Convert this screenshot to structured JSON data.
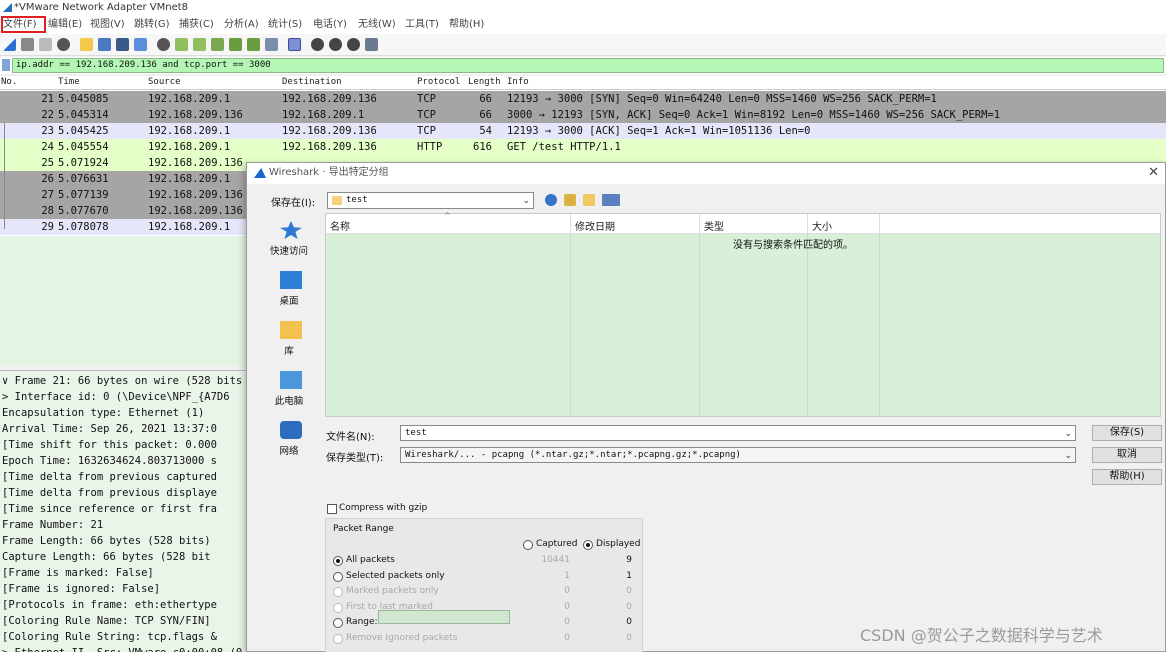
{
  "window": {
    "title": "*VMware Network Adapter VMnet8"
  },
  "menu": [
    "文件(F)",
    "编辑(E)",
    "视图(V)",
    "跳转(G)",
    "捕获(C)",
    "分析(A)",
    "统计(S)",
    "电话(Y)",
    "无线(W)",
    "工具(T)",
    "帮助(H)"
  ],
  "filter": {
    "value": "ip.addr == 192.168.209.136 and tcp.port == 3000"
  },
  "packet_list": {
    "columns": [
      "No.",
      "Time",
      "Source",
      "Destination",
      "Protocol",
      "Length",
      "Info"
    ],
    "rows": [
      {
        "no": "21",
        "time": "5.045085",
        "src": "192.168.209.1",
        "dst": "192.168.209.136",
        "proto": "TCP",
        "len": "66",
        "info": "12193 → 3000 [SYN] Seq=0 Win=64240 Len=0 MSS=1460 WS=256 SACK_PERM=1",
        "bg": "#a5a5a5"
      },
      {
        "no": "22",
        "time": "5.045314",
        "src": "192.168.209.136",
        "dst": "192.168.209.1",
        "proto": "TCP",
        "len": "66",
        "info": "3000 → 12193 [SYN, ACK] Seq=0 Ack=1 Win=8192 Len=0 MSS=1460 WS=256 SACK_PERM=1",
        "bg": "#a5a5a5"
      },
      {
        "no": "23",
        "time": "5.045425",
        "src": "192.168.209.1",
        "dst": "192.168.209.136",
        "proto": "TCP",
        "len": "54",
        "info": "12193 → 3000 [ACK] Seq=1 Ack=1 Win=1051136 Len=0",
        "bg": "#e6e6fa"
      },
      {
        "no": "24",
        "time": "5.045554",
        "src": "192.168.209.1",
        "dst": "192.168.209.136",
        "proto": "HTTP",
        "len": "616",
        "info": "GET /test HTTP/1.1",
        "bg": "#e4ffc7"
      },
      {
        "no": "25",
        "time": "5.071924",
        "src": "192.168.209.136",
        "dst": "",
        "proto": "",
        "len": "",
        "info": "",
        "bg": "#e4ffc7"
      },
      {
        "no": "26",
        "time": "5.076631",
        "src": "192.168.209.1",
        "dst": "",
        "proto": "",
        "len": "",
        "info": "",
        "bg": "#a5a5a5"
      },
      {
        "no": "27",
        "time": "5.077139",
        "src": "192.168.209.136",
        "dst": "",
        "proto": "",
        "len": "",
        "info": "",
        "bg": "#a5a5a5"
      },
      {
        "no": "28",
        "time": "5.077670",
        "src": "192.168.209.136",
        "dst": "",
        "proto": "",
        "len": "",
        "info": "",
        "bg": "#a5a5a5"
      },
      {
        "no": "29",
        "time": "5.078078",
        "src": "192.168.209.1",
        "dst": "",
        "proto": "",
        "len": "",
        "info": "",
        "bg": "#e6e6fa"
      }
    ]
  },
  "details": [
    "∨ Frame 21: 66 bytes on wire (528 bits",
    "  > Interface id: 0 (\\Device\\NPF_{A7D6",
    "    Encapsulation type: Ethernet (1)",
    "    Arrival Time: Sep 26, 2021 13:37:0",
    "    [Time shift for this packet: 0.000",
    "    Epoch Time: 1632634624.803713000 s",
    "    [Time delta from previous captured",
    "    [Time delta from previous displaye",
    "    [Time since reference or first fra",
    "    Frame Number: 21",
    "    Frame Length: 66 bytes (528 bits)",
    "    Capture Length: 66 bytes (528 bit",
    "    [Frame is marked: False]",
    "    [Frame is ignored: False]",
    "    [Protocols in frame: eth:ethertype",
    "    [Coloring Rule Name: TCP SYN/FIN]",
    "    [Coloring Rule String: tcp.flags &",
    "> Ethernet II, Src: VMware_c0:00:08 (0"
  ],
  "dialog": {
    "title": "Wireshark · 导出特定分组",
    "save_in_label": "保存在(I):",
    "save_in_value": "test",
    "places": [
      "快速访问",
      "桌面",
      "库",
      "此电脑",
      "网络"
    ],
    "file_columns": [
      "名称",
      "修改日期",
      "类型",
      "大小"
    ],
    "empty_message": "没有与搜索条件匹配的项。",
    "filename_label": "文件名(N):",
    "filename_value": "test",
    "filetype_label": "保存类型(T):",
    "filetype_value": "Wireshark/... - pcapng (*.ntar.gz;*.ntar;*.pcapng.gz;*.pcapng)",
    "buttons": {
      "save": "保存(S)",
      "cancel": "取消",
      "help": "帮助(H)"
    },
    "compress_label": "Compress with gzip",
    "packet_range": {
      "title": "Packet Range",
      "col_captured": "Captured",
      "col_displayed": "Displayed",
      "rows": [
        {
          "label": "All packets",
          "captured": "10441",
          "displayed": "9",
          "enabled": true,
          "selected": true
        },
        {
          "label": "Selected packets only",
          "captured": "1",
          "displayed": "1",
          "enabled": true,
          "selected": false
        },
        {
          "label": "Marked packets only",
          "captured": "0",
          "displayed": "0",
          "enabled": false,
          "selected": false
        },
        {
          "label": "First to last marked",
          "captured": "0",
          "displayed": "0",
          "enabled": false,
          "selected": false
        },
        {
          "label": "Range:",
          "captured": "0",
          "displayed": "0",
          "enabled": true,
          "selected": false
        },
        {
          "label": "Remove Ignored packets",
          "captured": "0",
          "displayed": "0",
          "enabled": false,
          "selected": false
        }
      ]
    }
  },
  "watermark": "CSDN @贺公子之数据科学与艺术"
}
